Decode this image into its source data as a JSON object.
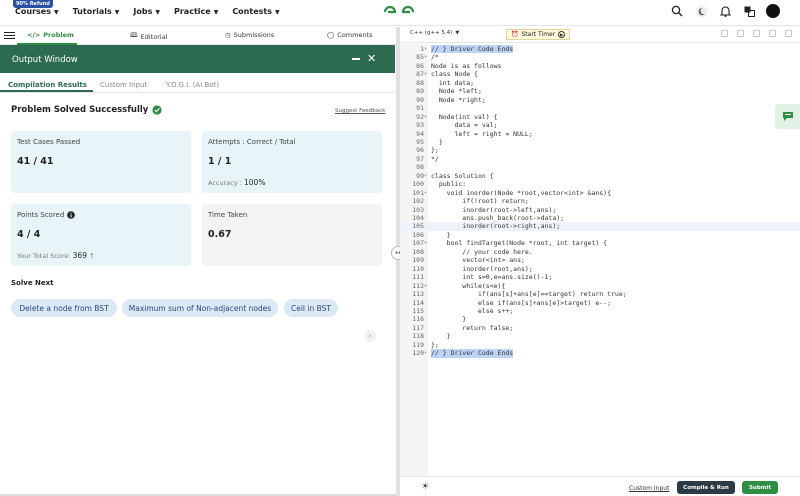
{
  "nav": {
    "badge": "90% Refund",
    "menu": [
      "Courses",
      "Tutorials",
      "Jobs",
      "Practice",
      "Contests"
    ]
  },
  "problem_tabs": [
    {
      "label": "Problem",
      "icon": "code-icon"
    },
    {
      "label": "Editorial",
      "icon": "book-icon"
    },
    {
      "label": "Submissions",
      "icon": "clock-icon"
    },
    {
      "label": "Comments",
      "icon": "comment-icon"
    }
  ],
  "output": {
    "title": "Output Window",
    "tabs": [
      "Compilation Results",
      "Custom Input",
      "Y.O.G.I. (AI Bot)"
    ],
    "solved_text": "Problem Solved Successfully",
    "suggest": "Suggest Feedback",
    "cards": {
      "test_label": "Test Cases Passed",
      "test_value": "41 / 41",
      "attempts_label": "Attempts : Correct / Total",
      "attempts_value": "1 / 1",
      "accuracy_label": "Accuracy :",
      "accuracy_value": "100%",
      "points_label": "Points Scored",
      "points_value": "4 / 4",
      "total_label": "Your Total Score:",
      "total_value": "369",
      "time_label": "Time Taken",
      "time_value": "0.67"
    },
    "solve_next_title": "Solve Next",
    "solve_next": [
      "Delete a node from BST",
      "Maximum sum of Non-adjacent nodes",
      "Ceil in BST"
    ]
  },
  "editor": {
    "language": "C++ (g++ 5.4)",
    "timer": "Start Timer",
    "lines": [
      {
        "n": "1",
        "text": "// } Driver Code Ends",
        "cls": "cm",
        "sel": true,
        "arrow": true
      },
      {
        "n": "85",
        "text": "/*",
        "cls": "cm",
        "arrow": true
      },
      {
        "n": "86",
        "text": "Node is as follows",
        "cls": "cm"
      },
      {
        "n": "87",
        "text": "class Node {",
        "cls": "cm",
        "arrow": true
      },
      {
        "n": "88",
        "text": "  int data;",
        "cls": "cm"
      },
      {
        "n": "89",
        "text": "  Node *left;",
        "cls": "cm"
      },
      {
        "n": "90",
        "text": "  Node *right;",
        "cls": "cm"
      },
      {
        "n": "91",
        "text": "",
        "cls": "cm"
      },
      {
        "n": "92",
        "text": "  Node(int val) {",
        "cls": "cm",
        "arrow": true
      },
      {
        "n": "93",
        "text": "      data = val;",
        "cls": "cm"
      },
      {
        "n": "94",
        "text": "      left = right = NULL;",
        "cls": "cm"
      },
      {
        "n": "95",
        "text": "  }",
        "cls": "cm"
      },
      {
        "n": "96",
        "text": "};",
        "cls": "cm"
      },
      {
        "n": "97",
        "text": "*/",
        "cls": "cm"
      },
      {
        "n": "98",
        "text": "",
        "cls": ""
      },
      {
        "n": "99",
        "text": "class Solution {",
        "cls": "",
        "arrow": true
      },
      {
        "n": "100",
        "text": "  public:",
        "cls": "kw"
      },
      {
        "n": "101",
        "text": "    void inorder(Node *root,vector<int> &ans){",
        "cls": "",
        "arrow": true
      },
      {
        "n": "102",
        "text": "        if(!root) return;",
        "cls": ""
      },
      {
        "n": "103",
        "text": "        inorder(root->left,ans);",
        "cls": ""
      },
      {
        "n": "104",
        "text": "        ans.push_back(root->data);",
        "cls": ""
      },
      {
        "n": "105",
        "text": "        inorder(root->right,ans);",
        "cls": "",
        "hl": true
      },
      {
        "n": "106",
        "text": "    }",
        "cls": ""
      },
      {
        "n": "107",
        "text": "    bool findTarget(Node *root, int target) {",
        "cls": "",
        "arrow": true
      },
      {
        "n": "108",
        "text": "        // your code here.",
        "cls": "cm"
      },
      {
        "n": "109",
        "text": "        vector<int> ans;",
        "cls": ""
      },
      {
        "n": "110",
        "text": "        inorder(root,ans);",
        "cls": ""
      },
      {
        "n": "111",
        "text": "        int s=0,e=ans.size()-1;",
        "cls": ""
      },
      {
        "n": "112",
        "text": "        while(s<e){",
        "cls": "",
        "arrow": true
      },
      {
        "n": "113",
        "text": "            if(ans[s]+ans[e]==target) return true;",
        "cls": ""
      },
      {
        "n": "114",
        "text": "            else if(ans[s]+ans[e]>target) e--;",
        "cls": ""
      },
      {
        "n": "115",
        "text": "            else s++;",
        "cls": ""
      },
      {
        "n": "116",
        "text": "        }",
        "cls": ""
      },
      {
        "n": "117",
        "text": "        return false;",
        "cls": ""
      },
      {
        "n": "118",
        "text": "    }",
        "cls": ""
      },
      {
        "n": "119",
        "text": "};",
        "cls": ""
      },
      {
        "n": "120",
        "text": "// } Driver Code Ends",
        "cls": "cm",
        "sel": true,
        "arrow": true
      }
    ],
    "custom_input": "Custom Input",
    "compile_run": "Compile & Run",
    "submit": "Submit"
  },
  "colors": {
    "brand_green": "#2f8d46",
    "header_green": "#2c6b4f",
    "card_blue": "#e8f5f8",
    "chip_blue": "#dde8f5"
  }
}
